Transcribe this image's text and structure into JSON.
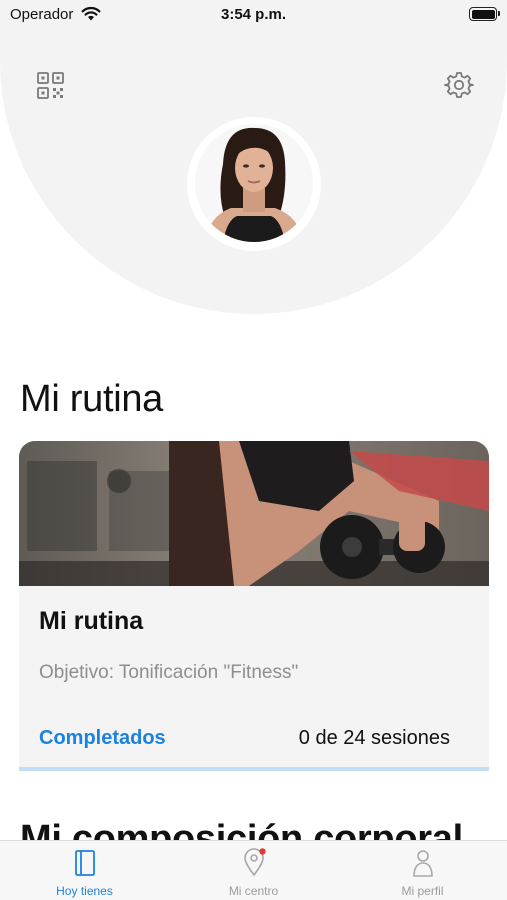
{
  "status_bar": {
    "carrier": "Operador",
    "time": "3:54 p.m."
  },
  "header": {
    "qr_icon": "qr-code-icon",
    "settings_icon": "gear-icon"
  },
  "section": {
    "title": "Mi rutina"
  },
  "routine_card": {
    "title": "Mi rutina",
    "objective": "Objetivo: Tonificación \"Fitness\"",
    "progress_label": "Completados",
    "progress_value": "0 de 24 sesiones",
    "accent_color": "#1a82e2"
  },
  "next_section": {
    "title": "Mi composición corporal"
  },
  "tab_bar": {
    "tabs": [
      {
        "label": "Hoy tienes",
        "icon": "book-icon",
        "active": true
      },
      {
        "label": "Mi centro",
        "icon": "location-pin-icon",
        "active": false,
        "badge": true
      },
      {
        "label": "Mi perfil",
        "icon": "person-icon",
        "active": false
      }
    ]
  }
}
